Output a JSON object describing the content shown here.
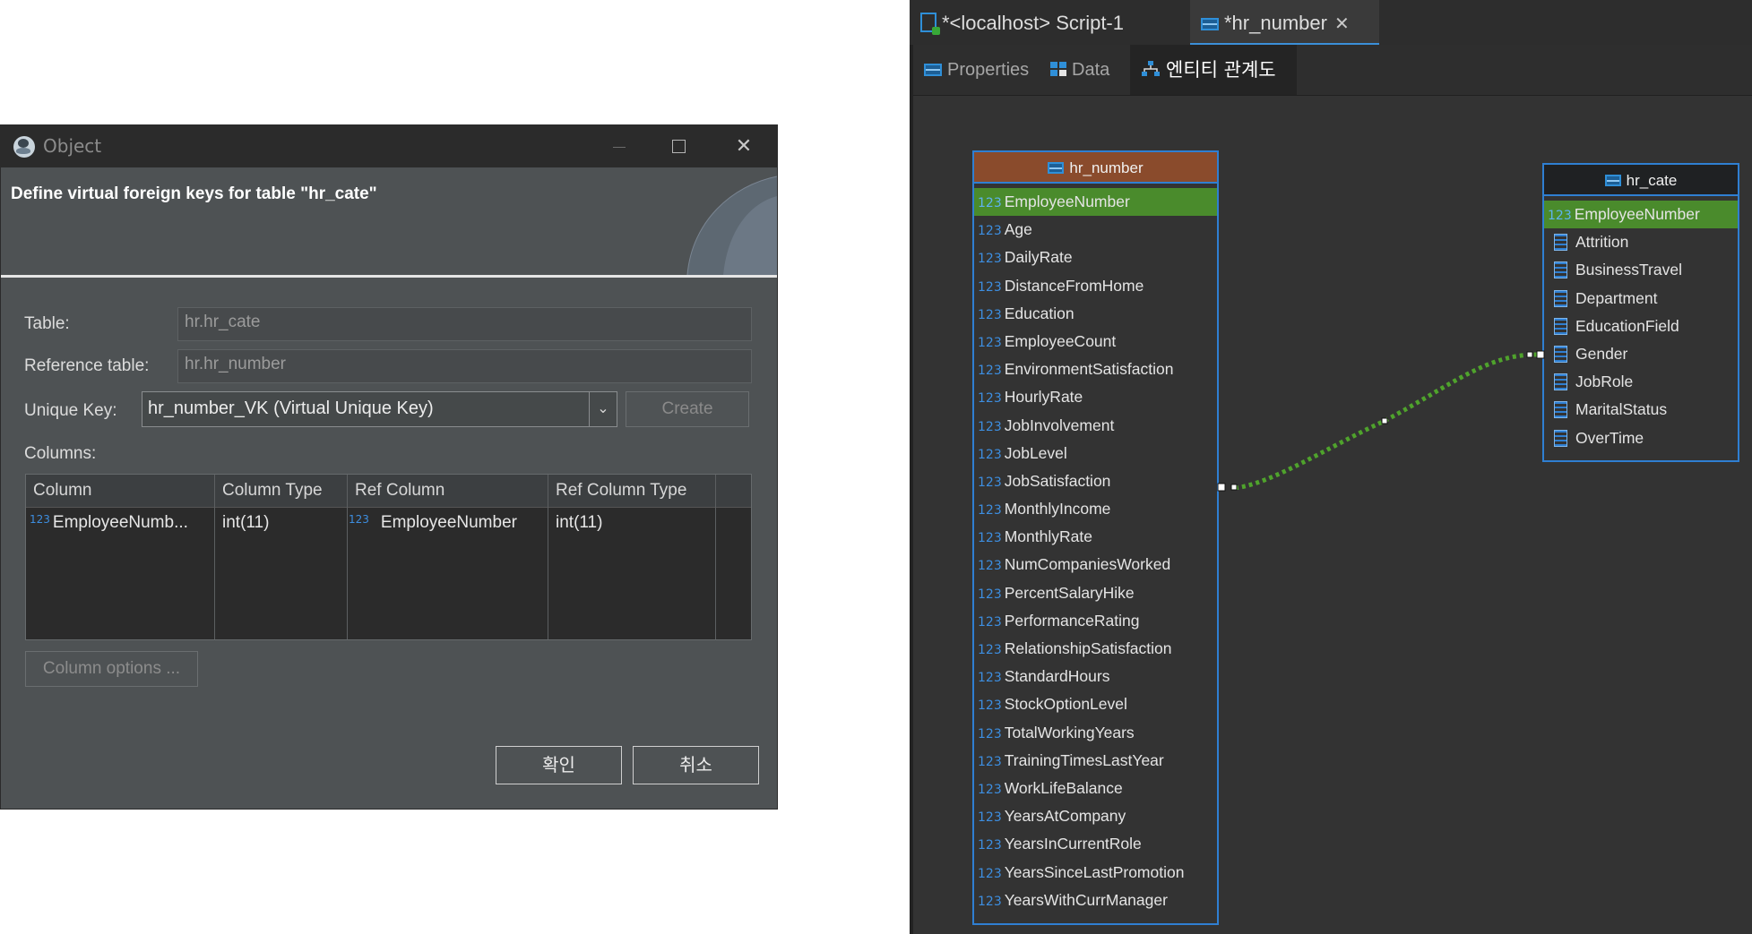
{
  "dialog": {
    "title": "Object",
    "header": "Define virtual foreign keys for table \"hr_cate\"",
    "table_label": "Table:",
    "table_value": "hr.hr_cate",
    "reference_table_label": "Reference table:",
    "reference_table_value": "hr.hr_number",
    "unique_key_label": "Unique Key:",
    "unique_key_value": "hr_number_VK (Virtual Unique Key)",
    "create_label": "Create",
    "columns_label": "Columns:",
    "columns_headers": [
      "Column",
      "Column Type",
      "Ref Column",
      "Ref Column Type"
    ],
    "columns_rows": [
      {
        "type_badge": "123",
        "column": "EmployeeNumb...",
        "column_type": "int(11)",
        "ref_badge": "123",
        "ref_column": "EmployeeNumber",
        "ref_column_type": "int(11)"
      }
    ],
    "column_options_label": "Column options ...",
    "ok_label": "확인",
    "cancel_label": "취소",
    "close_glyph": "✕"
  },
  "editor": {
    "tabs": [
      {
        "label": "*<localhost> Script-1"
      },
      {
        "label": "*hr_number"
      }
    ],
    "tab_close_glyph": "✕",
    "subtabs": [
      {
        "label": "Properties"
      },
      {
        "label": "Data"
      },
      {
        "label": "엔티티 관계도"
      }
    ]
  },
  "erd": {
    "numeric_badge": "123",
    "relationship_color": "#4fa32c",
    "entities": [
      {
        "name": "hr_number",
        "header_color": "#8a4b2c",
        "attributes": [
          {
            "name": "EmployeeNumber",
            "type": "numeric",
            "pk": true
          },
          {
            "name": "Age",
            "type": "numeric"
          },
          {
            "name": "DailyRate",
            "type": "numeric"
          },
          {
            "name": "DistanceFromHome",
            "type": "numeric"
          },
          {
            "name": "Education",
            "type": "numeric"
          },
          {
            "name": "EmployeeCount",
            "type": "numeric"
          },
          {
            "name": "EnvironmentSatisfaction",
            "type": "numeric"
          },
          {
            "name": "HourlyRate",
            "type": "numeric"
          },
          {
            "name": "JobInvolvement",
            "type": "numeric"
          },
          {
            "name": "JobLevel",
            "type": "numeric"
          },
          {
            "name": "JobSatisfaction",
            "type": "numeric"
          },
          {
            "name": "MonthlyIncome",
            "type": "numeric"
          },
          {
            "name": "MonthlyRate",
            "type": "numeric"
          },
          {
            "name": "NumCompaniesWorked",
            "type": "numeric"
          },
          {
            "name": "PercentSalaryHike",
            "type": "numeric"
          },
          {
            "name": "PerformanceRating",
            "type": "numeric"
          },
          {
            "name": "RelationshipSatisfaction",
            "type": "numeric"
          },
          {
            "name": "StandardHours",
            "type": "numeric"
          },
          {
            "name": "StockOptionLevel",
            "type": "numeric"
          },
          {
            "name": "TotalWorkingYears",
            "type": "numeric"
          },
          {
            "name": "TrainingTimesLastYear",
            "type": "numeric"
          },
          {
            "name": "WorkLifeBalance",
            "type": "numeric"
          },
          {
            "name": "YearsAtCompany",
            "type": "numeric"
          },
          {
            "name": "YearsInCurrentRole",
            "type": "numeric"
          },
          {
            "name": "YearsSinceLastPromotion",
            "type": "numeric"
          },
          {
            "name": "YearsWithCurrManager",
            "type": "numeric"
          }
        ]
      },
      {
        "name": "hr_cate",
        "header_color": "#1f2123",
        "attributes": [
          {
            "name": "EmployeeNumber",
            "type": "numeric",
            "pk": true
          },
          {
            "name": "Attrition",
            "type": "string"
          },
          {
            "name": "BusinessTravel",
            "type": "string"
          },
          {
            "name": "Department",
            "type": "string"
          },
          {
            "name": "EducationField",
            "type": "string"
          },
          {
            "name": "Gender",
            "type": "string"
          },
          {
            "name": "JobRole",
            "type": "string"
          },
          {
            "name": "MaritalStatus",
            "type": "string"
          },
          {
            "name": "OverTime",
            "type": "string"
          }
        ]
      }
    ]
  }
}
